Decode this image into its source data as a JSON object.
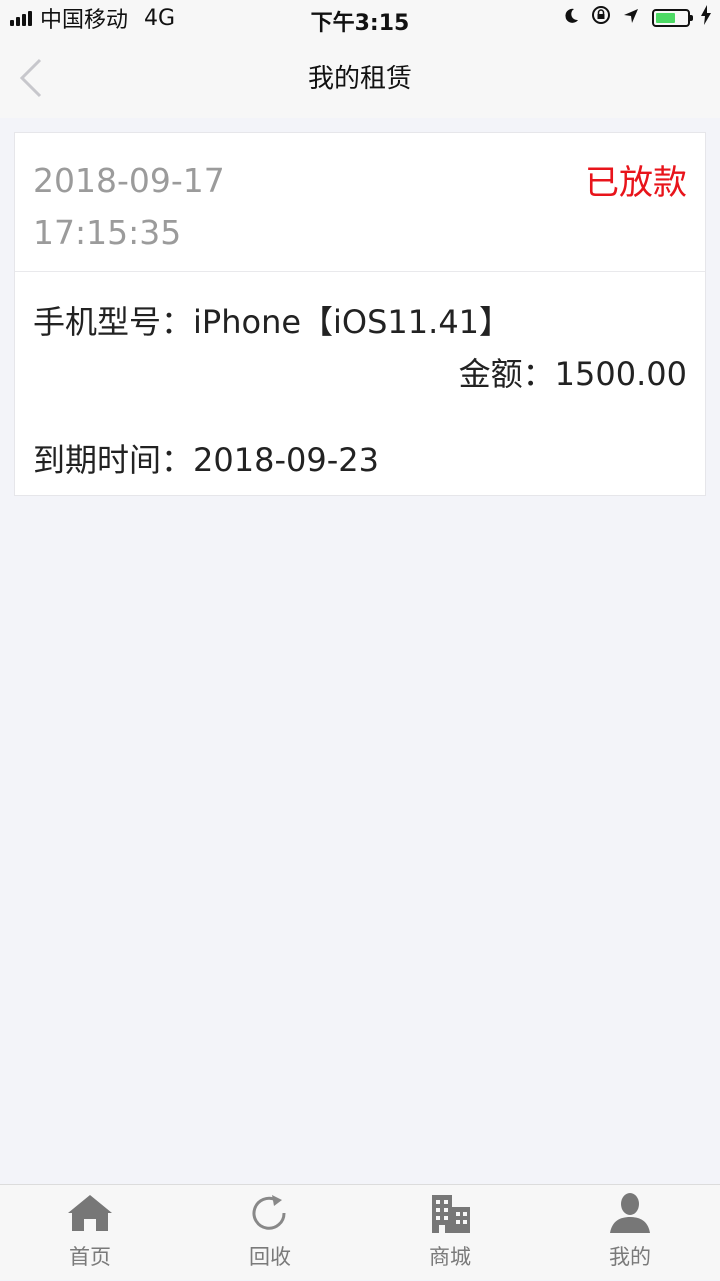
{
  "status_bar": {
    "carrier": "中国移动",
    "network": "4G",
    "time": "下午3:15"
  },
  "nav": {
    "title": "我的租赁"
  },
  "order": {
    "date": "2018-09-17",
    "time": "17:15:35",
    "status": "已放款",
    "status_color": "#e8141b",
    "model_label": "手机型号：",
    "model_value": "iPhone【iOS11.41】",
    "amount_label": "金额：",
    "amount_value": "1500.00",
    "due_label": "到期时间：",
    "due_value": "2018-09-23"
  },
  "tabs": [
    {
      "label": "首页",
      "icon": "home-icon"
    },
    {
      "label": "回收",
      "icon": "refresh-icon"
    },
    {
      "label": "商城",
      "icon": "building-icon"
    },
    {
      "label": "我的",
      "icon": "user-icon"
    }
  ]
}
